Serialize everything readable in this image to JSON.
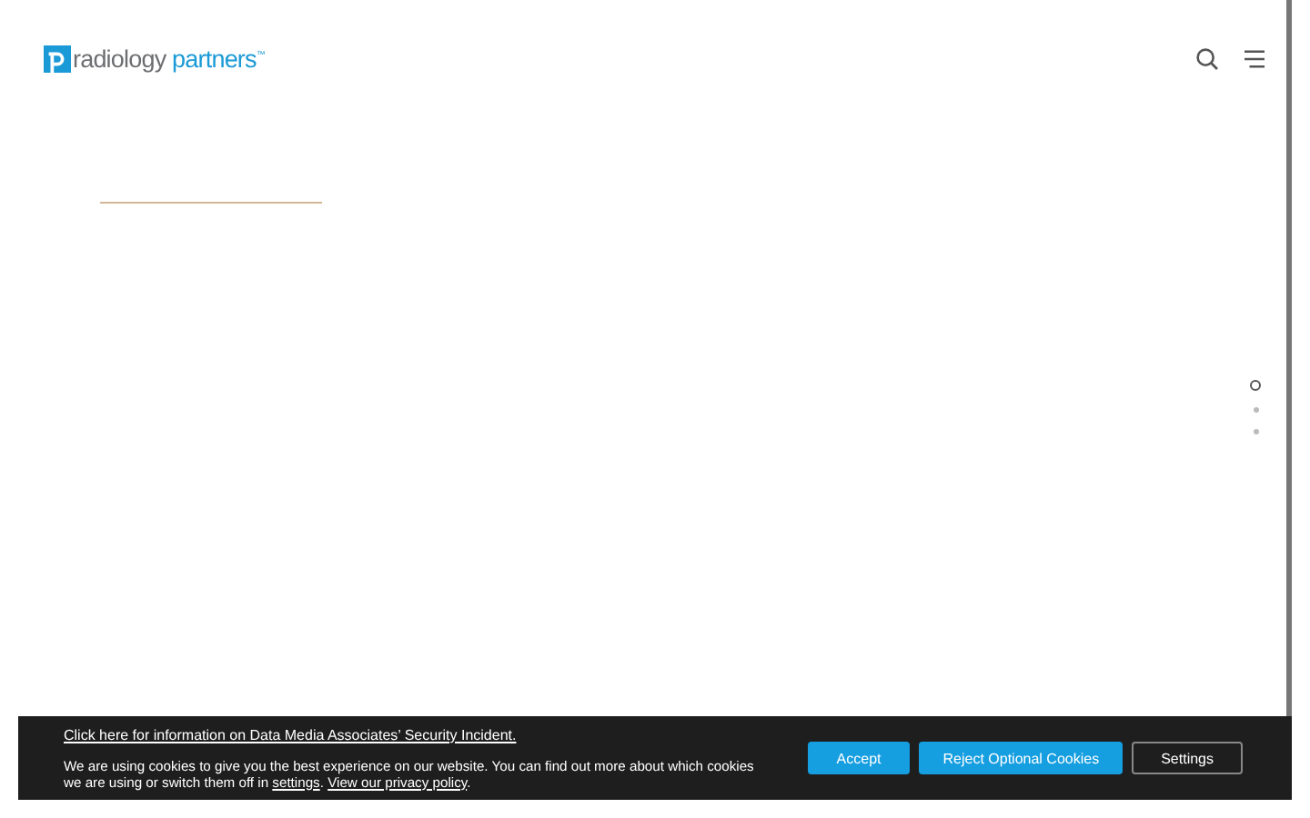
{
  "header": {
    "brand_first": "radiology",
    "brand_second": "partners",
    "brand_mark": "™"
  },
  "section_dots": [
    {
      "selected": true
    },
    {
      "selected": false
    },
    {
      "selected": false
    }
  ],
  "cookie_banner": {
    "incident_link": "Click here for information on Data Media Associates’ Security Incident.",
    "message": "We are using cookies to give you the best experience on our website. You can find out more about which cookies we are using or switch them off in ",
    "settings_link": "settings",
    "separator": ". ",
    "privacy_link": "View our privacy policy",
    "ending": ".",
    "buttons": [
      {
        "label": "Accept",
        "kind": "primary"
      },
      {
        "label": "Reject Optional Cookies",
        "kind": "primary"
      },
      {
        "label": "Settings",
        "kind": "outline"
      }
    ]
  }
}
